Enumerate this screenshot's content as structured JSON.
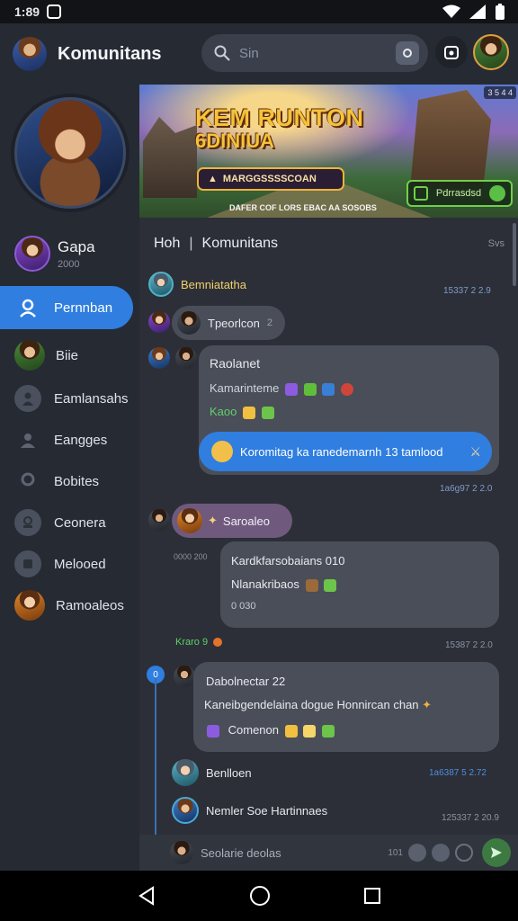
{
  "status_bar": {
    "time": "1:89",
    "right_icons": [
      "wifi-icon",
      "signal-icon",
      "battery-icon"
    ]
  },
  "app_bar": {
    "title": "Komunitans",
    "search_placeholder": "Sin"
  },
  "sidebar": {
    "user": {
      "name": "Gapa",
      "sub": "2000"
    },
    "items": [
      {
        "label": "Pernnban",
        "active": true
      },
      {
        "label": "Biie"
      },
      {
        "label": "Eamlansahs"
      },
      {
        "label": "Eangges"
      },
      {
        "label": "Bobites"
      },
      {
        "label": "Ceonera"
      },
      {
        "label": "Melooed"
      },
      {
        "label": "Ramoaleos"
      }
    ]
  },
  "banner": {
    "title_line1": "KEM RUNTON",
    "title_line2": "6DINIUA",
    "cta": "MARGGSSSSCOAN",
    "badge": "3 5 4 4",
    "footer": "DAFER COF LORS EBAC AA SOSOBS",
    "right_btn": "Pdrrasdsd"
  },
  "feed": {
    "head_left": "Hoh",
    "head_mid": "Komunitans",
    "head_right": "Svs",
    "posts": [
      {
        "author": "Bemniatatha",
        "time": "15337 2 2.9"
      },
      {
        "chip": "Tpeorlcon",
        "chip_count": "2"
      },
      {
        "title": "Raolanet",
        "line1": "Kamarinteme",
        "line2": "Kaoo",
        "action": "Koromitag ka ranedemarnh 13 tamlood",
        "time": "1a6g97 2 2.0"
      },
      {
        "chip": "Saroaleo",
        "meta": "0000 200"
      },
      {
        "title": "Kardkfarsobaians 010",
        "line1": "Nlanakribaos",
        "line2": "0 030",
        "reaction": "Kraro 9",
        "time": "15387 2 2.0"
      },
      {
        "title": "Dabolnectar 22",
        "line1": "Kaneibgendelaina dogue Honnircan chan",
        "line2": "Comenon"
      },
      {
        "name": "Benlloen",
        "time": "1a6387 5 2.72"
      },
      {
        "name": "Nemler Soe Hartinnaes",
        "time": "125337 2 20.9"
      }
    ]
  },
  "composer": {
    "placeholder": "Seolarie deolas",
    "count": "101"
  }
}
